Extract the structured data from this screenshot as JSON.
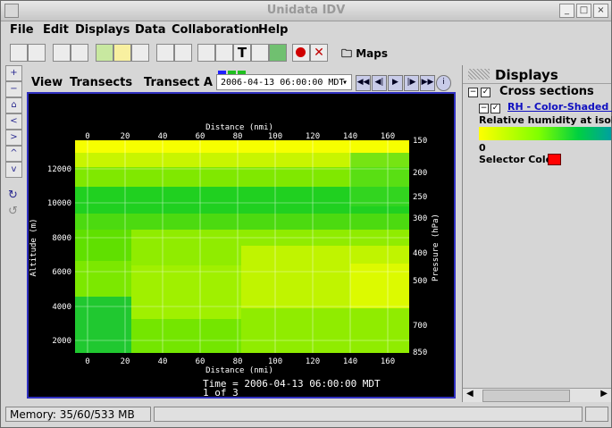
{
  "window": {
    "title": "Unidata IDV",
    "controls": [
      "_",
      "□",
      "×"
    ]
  },
  "menubar": [
    "File",
    "Edit",
    "Displays",
    "Data",
    "Collaboration",
    "Help"
  ],
  "toolbar": {
    "maps_label": "Maps"
  },
  "view": {
    "tabs": [
      "View",
      "Transects",
      "Transect A"
    ],
    "time_select": "2006-04-13 06:00:00 MDT",
    "animation_buttons": [
      "rewind",
      "step-back",
      "play",
      "step-forward",
      "fast-forward",
      "info"
    ]
  },
  "plot": {
    "top_axis_label": "Distance (nmi)",
    "bottom_axis_label": "Distance (nmi)",
    "left_axis_label": "Altitude (m)",
    "right_axis_label": "Pressure (hPa)",
    "x_ticks": [
      "0",
      "20",
      "40",
      "60",
      "80",
      "100",
      "120",
      "140",
      "160"
    ],
    "y_ticks": [
      "2000",
      "4000",
      "6000",
      "8000",
      "10000",
      "12000"
    ],
    "p_ticks": [
      "150",
      "200",
      "250",
      "300",
      "400",
      "500",
      "700",
      "850"
    ],
    "time_text": "Time = 2006-04-13 06:00:00 MDT",
    "frame_text": "1 of 3"
  },
  "displays_panel": {
    "title": "Displays",
    "group_label": "Cross sections",
    "layer_label": "RH - Color-Shaded Cr",
    "layer_desc": "Relative humidity at isobari",
    "colorbar_min": "0",
    "selector_label": "Selector Color:",
    "selector_color": "#ff0000"
  },
  "status": {
    "memory": "Memory: 35/60/533 MB"
  },
  "colors": {
    "canvas_border": "#3030c0",
    "link": "#1010c0"
  }
}
